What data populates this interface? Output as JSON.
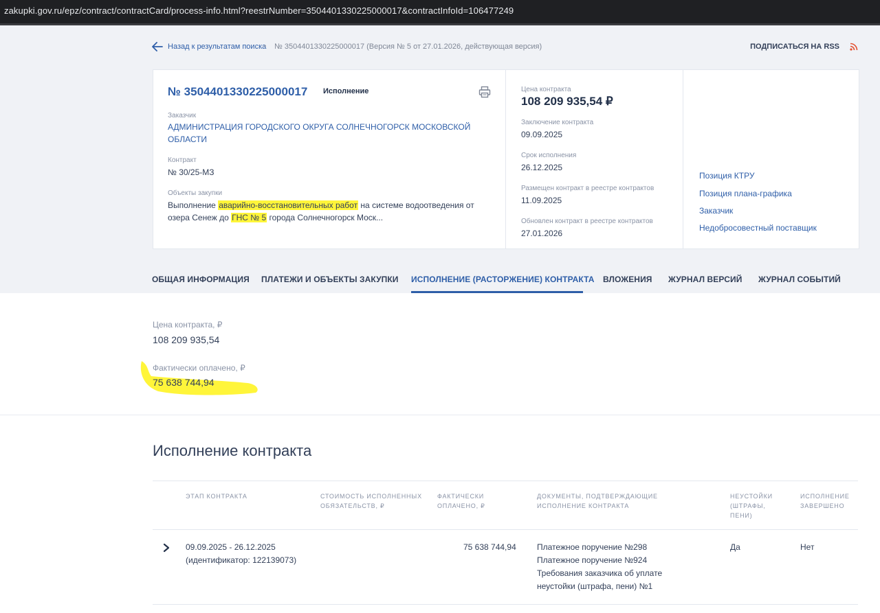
{
  "browser": {
    "url": "zakupki.gov.ru/epz/contract/contractCard/process-info.html?reestrNumber=3504401330225000017&contractInfoId=106477249"
  },
  "breadcrumb": {
    "back_label": "Назад к результатам поиска",
    "separator": "•",
    "current": "№ 3504401330225000017 (Версия № 5 от 27.01.2026, действующая версия)"
  },
  "rss": {
    "label": "ПОДПИСАТЬСЯ НА RSS",
    "icon": "rss-icon",
    "icon_color": "#e4502e"
  },
  "card": {
    "number": "№ 3504401330225000017",
    "status": "Исполнение",
    "customer_label": "Заказчик",
    "customer_line1": "АДМИНИСТРАЦИЯ ГОРОДСКОГО ОКРУГА СОЛНЕЧНОГОРСК МОСКОВСКОЙ",
    "customer_line2": "ОБЛАСТИ",
    "contract_label": "Контракт",
    "contract_value": "№ 30/25-МЗ",
    "objects_label": "Объекты закупки",
    "objects_l1_a": "Выполнение ",
    "objects_l1_hl": "аварийно-восстановительных работ",
    "objects_l1_b": " на системе водоотведения от",
    "objects_l2_a": "озера Сенеж до ",
    "objects_l2_hl": "ГНС № 5",
    "objects_l2_b": " города Солнечногорск Моск..."
  },
  "dates": {
    "price_label": "Цена контракта",
    "price_value": "108 209 935,54 ₽",
    "conclusion_label": "Заключение контракта",
    "conclusion_value": "09.09.2025",
    "term_label": "Срок исполнения",
    "term_value": "26.12.2025",
    "placed_label": "Размещен контракт в реестре контрактов",
    "placed_value": "11.09.2025",
    "updated_label": "Обновлен контракт в реестре контрактов",
    "updated_value": "27.01.2026"
  },
  "side_links": [
    "Позиция КТРУ",
    "Позиция плана-графика",
    "Заказчик",
    "Недобросовестный поставщик"
  ],
  "tabs": [
    "ОБЩАЯ ИНФОРМАЦИЯ",
    "ПЛАТЕЖИ И ОБЪЕКТЫ ЗАКУПКИ",
    "ИСПОЛНЕНИЕ (РАСТОРЖЕНИЕ) КОНТРАКТА",
    "ВЛОЖЕНИЯ",
    "ЖУРНАЛ ВЕРСИЙ",
    "ЖУРНАЛ СОБЫТИЙ"
  ],
  "finance": {
    "price_label": "Цена контракта, ₽",
    "price_value": "108 209 935,54",
    "paid_label": "Фактически оплачено, ₽",
    "paid_value": "75 638 744,94"
  },
  "section": {
    "title": "Исполнение контракта"
  },
  "table": {
    "h_stage": "ЭТАП КОНТРАКТА",
    "h_cost_1": "СТОИМОСТЬ ИСПОЛНЕННЫХ",
    "h_cost_2": "ОБЯЗАТЕЛЬСТВ, ₽",
    "h_paid_1": "ФАКТИЧЕСКИ",
    "h_paid_2": "ОПЛАЧЕНО, ₽",
    "h_docs_1": "ДОКУМЕНТЫ, ПОДТВЕРЖДАЮЩИЕ",
    "h_docs_2": "ИСПОЛНЕНИЕ КОНТРАКТА",
    "h_pen_1": "НЕУСТОЙКИ",
    "h_pen_2": "(ШТРАФЫ,",
    "h_pen_3": "ПЕНИ)",
    "h_done_1": "ИСПОЛНЕНИЕ",
    "h_done_2": "ЗАВЕРШЕНО",
    "row": {
      "stage_1": "09.09.2025 - 26.12.2025",
      "stage_2": "(идентификатор: 122139073)",
      "paid": "75 638 744,94",
      "doc_1": "Платежное поручение №298",
      "doc_2": "Платежное поручение №924",
      "doc_3": "Требования заказчика об уплате",
      "doc_4": "неустойки (штрафа, пени) №1",
      "penalties": "Да",
      "completed": "Нет"
    }
  },
  "colors": {
    "accent": "#2e5ea8",
    "highlight": "#fff53a",
    "gray_bg": "#f0f2f6"
  }
}
